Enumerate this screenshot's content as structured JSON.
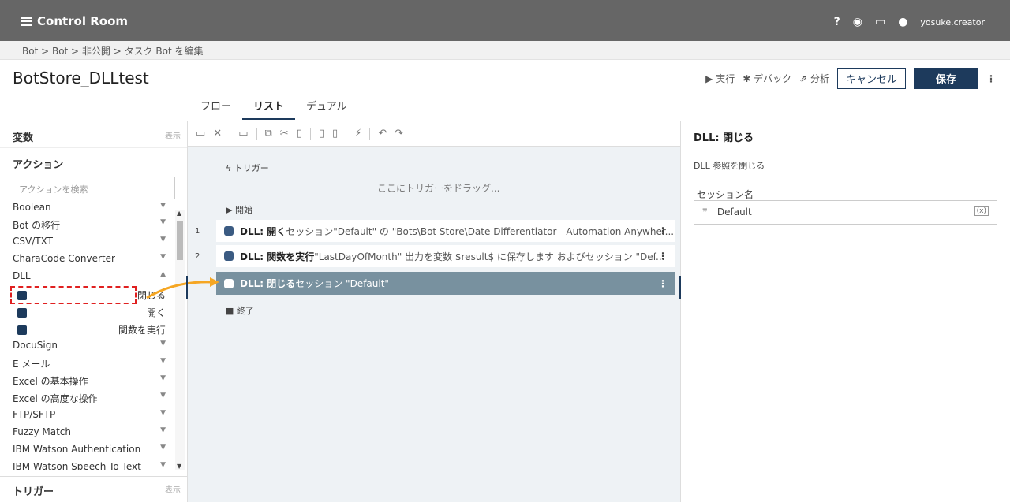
{
  "app": {
    "brand": "Control Room",
    "user": "yosuke.creator"
  },
  "breadcrumb": "Bot > Bot > 非公開 > タスク Bot を編集",
  "title": "BotStore_DLLtest",
  "header_actions": {
    "run": "▶ 実行",
    "debug": "✱ デバック",
    "analyze": "⇗ 分析",
    "cancel": "キャンセル",
    "save": "保存"
  },
  "tabs": [
    "フロー",
    "リスト",
    "デュアル"
  ],
  "left": {
    "variables": "変数",
    "show": "表示",
    "actions_title": "アクション",
    "search_placeholder": "アクションを検索",
    "items": [
      "Boolean",
      "Bot の移行",
      "CSV/TXT",
      "CharaCode Converter",
      "DLL"
    ],
    "dll_sub": [
      "閉じる",
      "開く",
      "関数を実行"
    ],
    "items2": [
      "DocuSign",
      "E メール",
      "Excel の基本操作",
      "Excel の高度な操作",
      "FTP/SFTP",
      "Fuzzy Match",
      "IBM Watson Authentication",
      "IBM Watson Speech To Text"
    ],
    "triggers": "トリガー"
  },
  "center": {
    "trigger": "トリガー",
    "drop_hint": "ここにトリガーをドラッグ...",
    "start": "開始",
    "end": "終了",
    "steps": [
      {
        "num": "1",
        "action": "DLL: 開く",
        "detail": " セッション\"Default\" の \"Bots\\Bot Store\\Date Differentiator - Automation Anywher..."
      },
      {
        "num": "2",
        "action": "DLL: 関数を実行",
        "detail": " \"LastDayOfMonth\" 出力を変数 $result$ に保存します およびセッション \"Def..."
      },
      {
        "num": "",
        "action": "DLL: 閉じる",
        "detail": " セッション \"Default\""
      }
    ]
  },
  "right": {
    "header": "DLL: 閉じる",
    "desc": "DLL 参照を閉じる",
    "session_label": "セッション名",
    "session_value": "Default"
  }
}
